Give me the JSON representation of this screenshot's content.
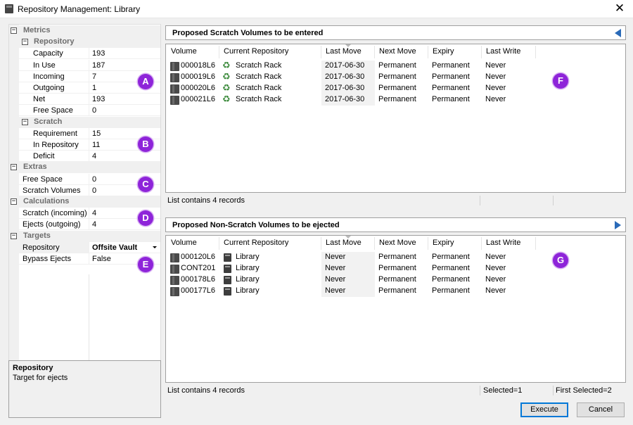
{
  "window": {
    "title": "Repository Management: Library"
  },
  "propgrid": {
    "rows": [
      {
        "kind": "cat",
        "level": 0,
        "label": "Metrics"
      },
      {
        "kind": "cat",
        "level": 1,
        "label": "Repository"
      },
      {
        "kind": "item",
        "level": 2,
        "label": "Capacity",
        "value": "193"
      },
      {
        "kind": "item",
        "level": 2,
        "label": "In Use",
        "value": "187"
      },
      {
        "kind": "item",
        "level": 2,
        "label": "Incoming",
        "value": "7"
      },
      {
        "kind": "item",
        "level": 2,
        "label": "Outgoing",
        "value": "1"
      },
      {
        "kind": "item",
        "level": 2,
        "label": "Net",
        "value": "193"
      },
      {
        "kind": "item",
        "level": 2,
        "label": "Free Space",
        "value": "0"
      },
      {
        "kind": "cat",
        "level": 1,
        "label": "Scratch"
      },
      {
        "kind": "item",
        "level": 2,
        "label": "Requirement",
        "value": "15"
      },
      {
        "kind": "item",
        "level": 2,
        "label": "In Repository",
        "value": "11"
      },
      {
        "kind": "item",
        "level": 2,
        "label": "Deficit",
        "value": "4"
      },
      {
        "kind": "cat",
        "level": 0,
        "label": "Extras"
      },
      {
        "kind": "item",
        "level": 1,
        "label": "Free Space",
        "value": "0"
      },
      {
        "kind": "item",
        "level": 1,
        "label": "Scratch Volumes",
        "value": "0"
      },
      {
        "kind": "cat",
        "level": 0,
        "label": "Calculations"
      },
      {
        "kind": "item",
        "level": 1,
        "label": "Scratch (incoming)",
        "value": "4"
      },
      {
        "kind": "item",
        "level": 1,
        "label": "Ejects (outgoing)",
        "value": "4"
      },
      {
        "kind": "cat",
        "level": 0,
        "label": "Targets"
      },
      {
        "kind": "item",
        "level": 1,
        "label": "Repository",
        "value": "Offsite Vault",
        "bold": true,
        "dropdown": true,
        "selected": true
      },
      {
        "kind": "item",
        "level": 1,
        "label": "Bypass Ejects",
        "value": "False"
      }
    ],
    "description": {
      "title": "Repository",
      "text": "Target for ejects"
    }
  },
  "badges": [
    "A",
    "B",
    "C",
    "D",
    "E",
    "F",
    "G"
  ],
  "columns": [
    "Volume",
    "Current Repository",
    "Last Move",
    "Next Move",
    "Expiry",
    "Last Write"
  ],
  "scratch_panel": {
    "title": "Proposed Scratch Volumes to be entered",
    "arrow": "collapse-left-arrow",
    "rows": [
      {
        "volume": "000018L6",
        "repository": "Scratch Rack",
        "last_move": "2017-06-30",
        "next_move": "Permanent",
        "expiry": "Permanent",
        "last_write": "Never"
      },
      {
        "volume": "000019L6",
        "repository": "Scratch Rack",
        "last_move": "2017-06-30",
        "next_move": "Permanent",
        "expiry": "Permanent",
        "last_write": "Never"
      },
      {
        "volume": "000020L6",
        "repository": "Scratch Rack",
        "last_move": "2017-06-30",
        "next_move": "Permanent",
        "expiry": "Permanent",
        "last_write": "Never"
      },
      {
        "volume": "000021L6",
        "repository": "Scratch Rack",
        "last_move": "2017-06-30",
        "next_move": "Permanent",
        "expiry": "Permanent",
        "last_write": "Never"
      }
    ],
    "status": "List contains 4 records"
  },
  "eject_panel": {
    "title": "Proposed Non-Scratch Volumes to be ejected",
    "arrow": "expand-right-arrow",
    "rows": [
      {
        "volume": "000120L6",
        "repository": "Library",
        "last_move": "Never",
        "next_move": "Permanent",
        "expiry": "Permanent",
        "last_write": "Never"
      },
      {
        "volume": "CONT201",
        "repository": "Library",
        "last_move": "Never",
        "next_move": "Permanent",
        "expiry": "Permanent",
        "last_write": "Never"
      },
      {
        "volume": "000178L6",
        "repository": "Library",
        "last_move": "Never",
        "next_move": "Permanent",
        "expiry": "Permanent",
        "last_write": "Never"
      },
      {
        "volume": "000177L6",
        "repository": "Library",
        "last_move": "Never",
        "next_move": "Permanent",
        "expiry": "Permanent",
        "last_write": "Never"
      }
    ],
    "status": "List contains 4 records",
    "selected": "Selected=1",
    "first_selected": "First Selected=2"
  },
  "buttons": {
    "execute": "Execute",
    "cancel": "Cancel"
  },
  "colors": {
    "badge": "#8e24d9",
    "accent": "#2a6ab8",
    "recycle": "#3c8a3c"
  }
}
